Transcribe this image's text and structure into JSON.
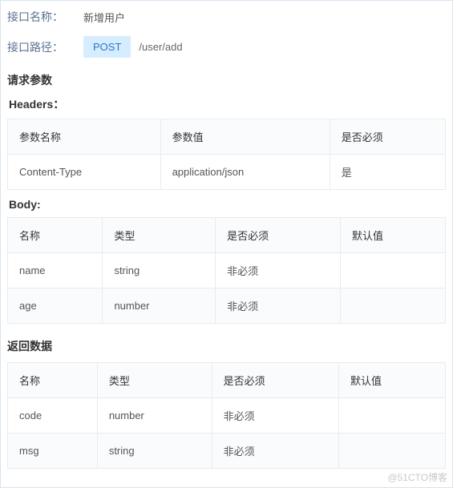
{
  "meta": {
    "name_label": "接口名称：",
    "name_value": "新增用户",
    "path_label": "接口路径：",
    "method": "POST",
    "path": "/user/add"
  },
  "request": {
    "title": "请求参数",
    "headers_title": "Headers：",
    "headers_table": {
      "cols": [
        "参数名称",
        "参数值",
        "是否必须"
      ],
      "rows": [
        [
          "Content-Type",
          "application/json",
          "是"
        ]
      ]
    },
    "body_title": "Body:",
    "body_table": {
      "cols": [
        "名称",
        "类型",
        "是否必须",
        "默认值"
      ],
      "rows": [
        [
          "name",
          "string",
          "非必须",
          ""
        ],
        [
          "age",
          "number",
          "非必须",
          ""
        ]
      ]
    }
  },
  "response": {
    "title": "返回数据",
    "table": {
      "cols": [
        "名称",
        "类型",
        "是否必须",
        "默认值"
      ],
      "rows": [
        [
          "code",
          "number",
          "非必须",
          ""
        ],
        [
          "msg",
          "string",
          "非必须",
          ""
        ]
      ]
    }
  },
  "watermark": "@51CTO博客"
}
